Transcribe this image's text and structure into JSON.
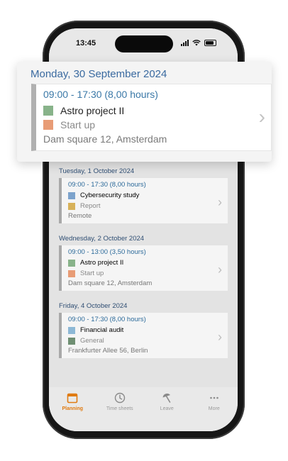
{
  "status": {
    "time": "13:45"
  },
  "popup": {
    "date": "Monday, 30 September 2024",
    "range": "09:00 - 17:30 (8,00 hours)",
    "project": "Astro project II",
    "project_color": "#88b38a",
    "task": "Start up",
    "task_color": "#e89c76",
    "location": "Dam square 12, Amsterdam"
  },
  "days": [
    {
      "date": "Tuesday, 1 October 2024",
      "range": "09:00 - 17:30 (8,00 hours)",
      "project": "Cybersecurity study",
      "project_color": "#7da3cc",
      "task": "Report",
      "task_color": "#d8b25a",
      "location": "Remote"
    },
    {
      "date": "Wednesday, 2 October 2024",
      "range": "09:00 - 13:00 (3,50 hours)",
      "project": "Astro project II",
      "project_color": "#88b38a",
      "task": "Start up",
      "task_color": "#e89c76",
      "location": "Dam square 12, Amsterdam"
    },
    {
      "date": "Friday, 4 October 2024",
      "range": "09:00 - 17:30 (8,00 hours)",
      "project": "Financial audit",
      "project_color": "#8db8d6",
      "task": "General",
      "task_color": "#6f8f73",
      "location": "Frankfurter Allee 56, Berlin"
    }
  ],
  "tabs": [
    {
      "label": "Planning",
      "icon": "calendar-icon",
      "active": true
    },
    {
      "label": "Time sheets",
      "icon": "clock-icon",
      "active": false
    },
    {
      "label": "Leave",
      "icon": "beach-umbrella-icon",
      "active": false
    },
    {
      "label": "More",
      "icon": "more-dots-icon",
      "active": false
    }
  ]
}
